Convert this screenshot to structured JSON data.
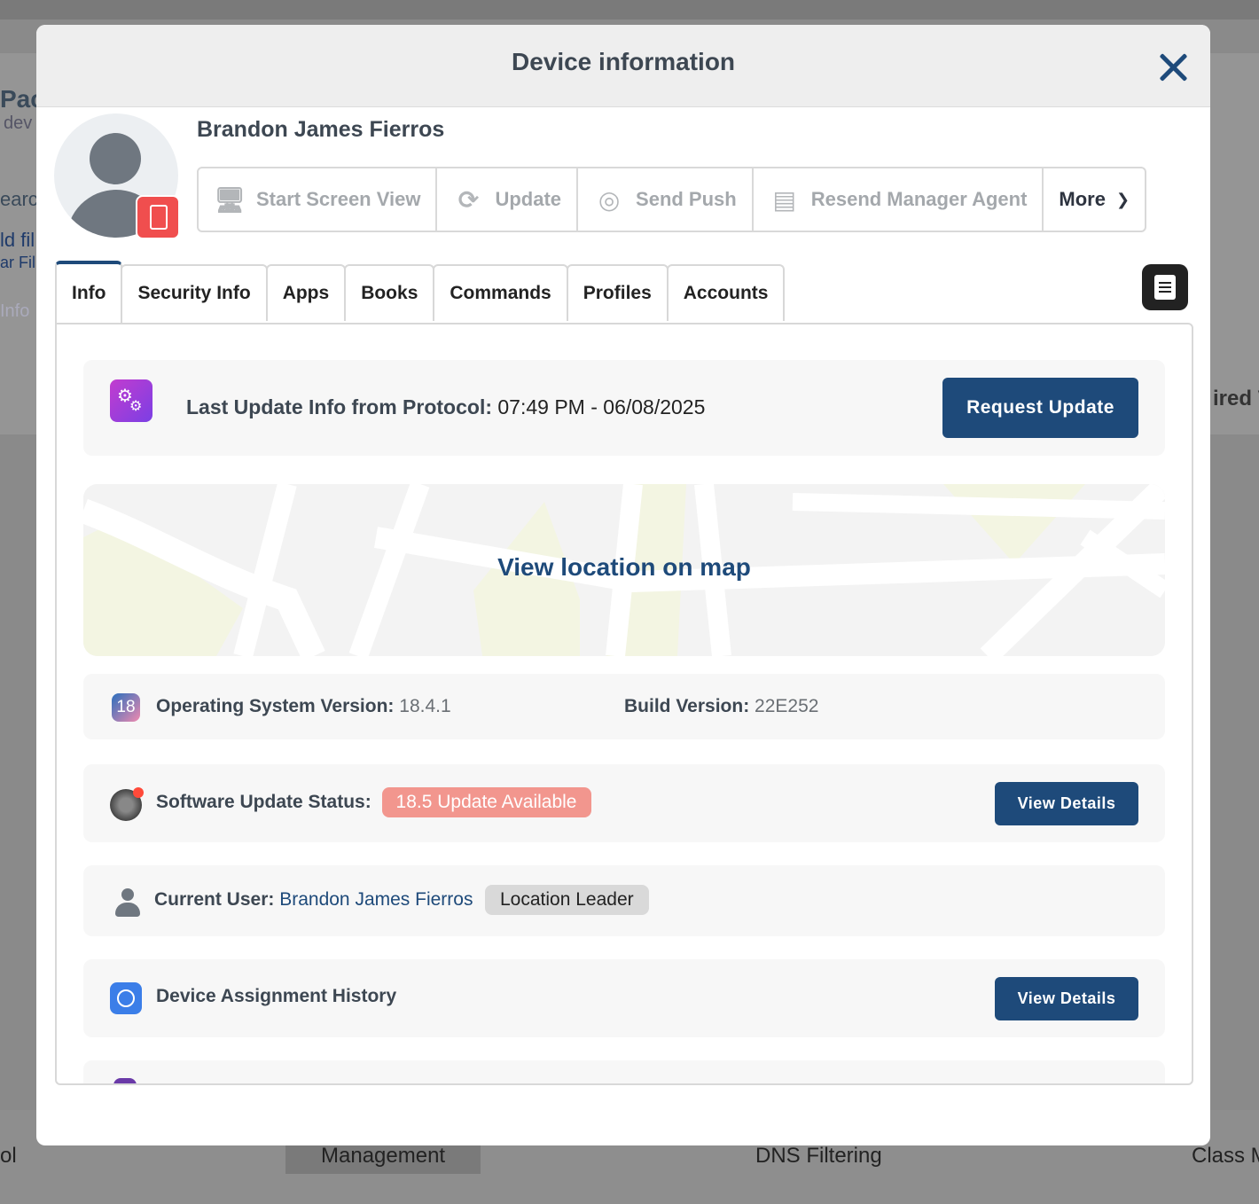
{
  "background": {
    "left_texts": [
      "Pac",
      "dev",
      "earc",
      "ld fil",
      "ar Fil",
      "Info"
    ],
    "right_text": "ired V",
    "bottom_tabs": [
      "ol",
      "Management",
      "DNS Filtering",
      "Class M"
    ]
  },
  "modal": {
    "title": "Device information",
    "user_name": "Brandon James Fierros",
    "actions": [
      {
        "label": "Start Screen View",
        "icon": "screen-view-icon"
      },
      {
        "label": "Update",
        "icon": "refresh-icon"
      },
      {
        "label": "Send Push",
        "icon": "push-icon"
      },
      {
        "label": "Resend Manager Agent",
        "icon": "resend-icon"
      },
      {
        "label": "More",
        "icon": "chevron-down-icon"
      }
    ],
    "tabs": [
      "Info",
      "Security Info",
      "Apps",
      "Books",
      "Commands",
      "Profiles",
      "Accounts"
    ],
    "active_tab": "Info"
  },
  "info": {
    "last_update_label": "Last Update Info from Protocol:",
    "last_update_value": "07:49 PM - 06/08/2025",
    "request_update_button": "Request Update",
    "map_link": "View location on map",
    "os_label": "Operating System Version:",
    "os_value": "18.4.1",
    "os_icon_text": "18",
    "build_label": "Build Version:",
    "build_value": "22E252",
    "software_update_label": "Software Update Status:",
    "software_update_badge": "18.5 Update Available",
    "view_details_1": "View Details",
    "current_user_label": "Current User:",
    "current_user_value": "Brandon James Fierros",
    "current_user_role": "Location Leader",
    "assignment_history_label": "Device Assignment History",
    "view_details_2": "View Details"
  },
  "colors": {
    "primary": "#1e4a7a",
    "update_badge": "#f2968e",
    "device_badge": "#f04e4e"
  }
}
